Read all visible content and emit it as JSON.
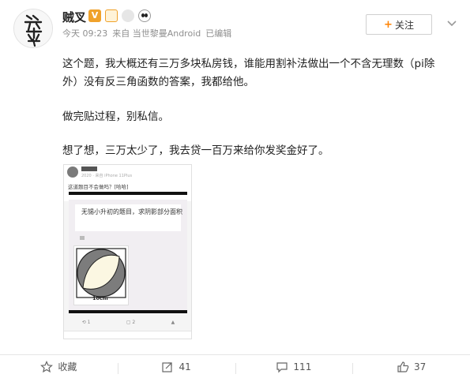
{
  "user": {
    "name": "贼叉",
    "avatar_text": "家典学",
    "time": "今天 09:23",
    "source": "来自 当世黎曼Android",
    "edited": "已编辑"
  },
  "follow_label": "关注",
  "post": {
    "paragraph1": "这个题，我大概还有三万多块私房钱，谁能用割补法做出一个不含无理数（pi除外）没有反三角函数的答案，我都给他。",
    "paragraph2": "做完贴过程，别私信。",
    "paragraph3": "想了想，三万太少了，我去贷一百万来给你发奖金好了。"
  },
  "embedded": {
    "subline": "2020 · 来自 iPhone 11Plus",
    "question": "这道题目不会做吗？[哈哈]",
    "title": "无锡小升初的题目，求阴影部分面积",
    "figure_label": "10cm",
    "repost_count": "1",
    "comment_count": "2"
  },
  "actions": {
    "favorite_label": "收藏",
    "repost_count": "41",
    "comment_count": "111",
    "like_count": "37"
  },
  "colors": {
    "accent": "#ff8200",
    "badge_gold": "#f0a22b",
    "text_secondary": "#8f8f8f"
  },
  "icons": [
    "more-icon",
    "favorite-icon",
    "repost-icon",
    "comment-icon",
    "like-icon",
    "verified-icon",
    "vip-icon",
    "medal-icon",
    "panda-icon"
  ]
}
